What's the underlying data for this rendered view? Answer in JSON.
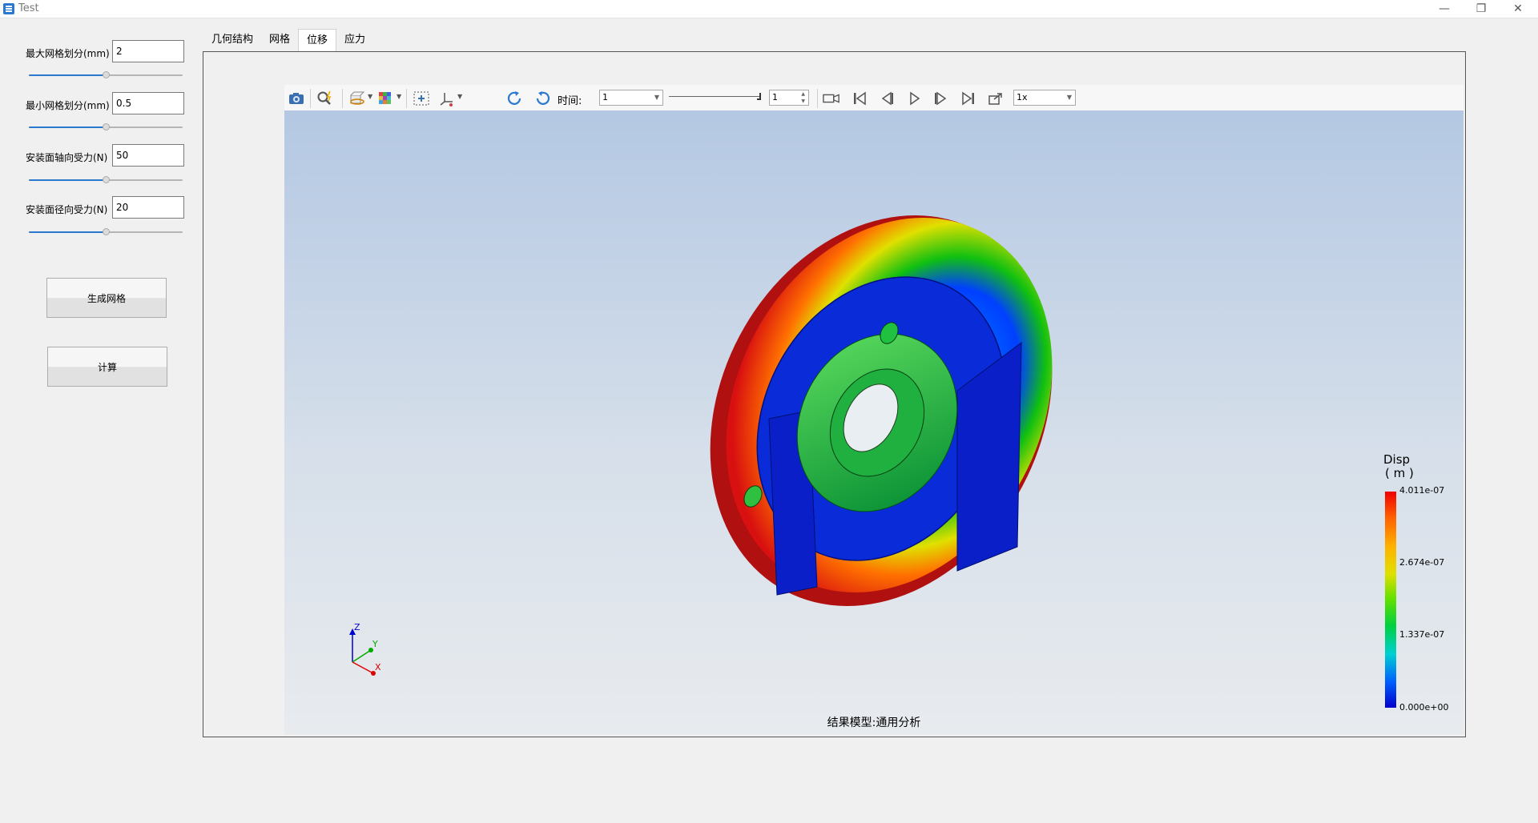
{
  "window": {
    "title": "Test"
  },
  "params": [
    {
      "label": "最大网格划分(mm)",
      "value": "2",
      "slider": 0.5
    },
    {
      "label": "最小网格划分(mm)",
      "value": "0.5",
      "slider": 0.5
    },
    {
      "label": "安装面轴向受力(N)",
      "value": "50",
      "slider": 0.5
    },
    {
      "label": "安装面径向受力(N)",
      "value": "20",
      "slider": 0.5
    }
  ],
  "buttons": {
    "generate_mesh": "生成网格",
    "compute": "计算"
  },
  "tabs": [
    {
      "label": "几何结构",
      "active": false
    },
    {
      "label": "网格",
      "active": false
    },
    {
      "label": "位移",
      "active": true
    },
    {
      "label": "应力",
      "active": false
    }
  ],
  "toolbar": {
    "time_label": "时间:",
    "time_value": "1",
    "step_value": "1",
    "speed_value": "1x",
    "icons": [
      "camera-icon",
      "zoom-icon",
      "display-mode-icon",
      "color-map-icon",
      "fit-view-icon",
      "axis-view-icon",
      "rotate-cw-icon",
      "rotate-ccw-icon",
      "record-icon",
      "first-frame-icon",
      "prev-frame-icon",
      "play-icon",
      "next-frame-icon",
      "last-frame-icon",
      "export-icon"
    ]
  },
  "viewport": {
    "result_label": "结果模型:通用分析",
    "legend": {
      "title": "Disp",
      "unit": "( m )",
      "values": [
        "4.011e-07",
        "2.674e-07",
        "1.337e-07",
        "0.000e+00"
      ]
    },
    "axes": {
      "x": "X",
      "y": "Y",
      "z": "Z"
    }
  },
  "colors": {
    "accent": "#2a79cf",
    "max": "#ee0000",
    "min": "#0000cc"
  }
}
